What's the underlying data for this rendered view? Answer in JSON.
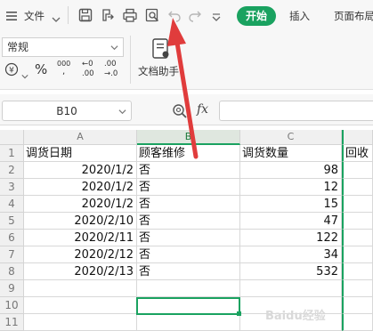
{
  "toolbar": {
    "menu_icon": "hamburger-icon",
    "file_label": "文件",
    "start_tab": "开始",
    "insert_tab": "插入",
    "page_layout_tab": "页面布局"
  },
  "ribbon": {
    "number_format": "常规",
    "percent_symbol": "%",
    "thousands_label": "000",
    "inc_decimal_top": "←0",
    "inc_decimal_bottom": ".00",
    "dec_decimal_top": ".00",
    "dec_decimal_bottom": "→.0",
    "doc_helper_label": "文档助手"
  },
  "formula_bar": {
    "cell_ref": "B10",
    "fx_label": "fx",
    "formula_value": ""
  },
  "sheet": {
    "columns": [
      "A",
      "B",
      "C"
    ],
    "rows": [
      {
        "num": "1",
        "a": "调货日期",
        "b": "顾客维修",
        "c": "调货数量",
        "d": "回收"
      },
      {
        "num": "2",
        "a": "2020/1/2",
        "b": "否",
        "c": "98",
        "d": ""
      },
      {
        "num": "3",
        "a": "2020/1/2",
        "b": "否",
        "c": "12",
        "d": ""
      },
      {
        "num": "4",
        "a": "2020/1/2",
        "b": "否",
        "c": "15",
        "d": ""
      },
      {
        "num": "5",
        "a": "2020/2/10",
        "b": "否",
        "c": "47",
        "d": ""
      },
      {
        "num": "6",
        "a": "2020/2/11",
        "b": "否",
        "c": "122",
        "d": ""
      },
      {
        "num": "7",
        "a": "2020/2/12",
        "b": "否",
        "c": "34",
        "d": ""
      },
      {
        "num": "8",
        "a": "2020/2/13",
        "b": "否",
        "c": "532",
        "d": ""
      },
      {
        "num": "9",
        "a": "",
        "b": "",
        "c": "",
        "d": ""
      },
      {
        "num": "10",
        "a": "",
        "b": "",
        "c": "",
        "d": ""
      },
      {
        "num": "11",
        "a": "",
        "b": "",
        "c": "",
        "d": ""
      }
    ]
  },
  "colors": {
    "accent": "#1aa260",
    "arrow": "#e03c3c"
  },
  "watermark": "Baidu经验"
}
